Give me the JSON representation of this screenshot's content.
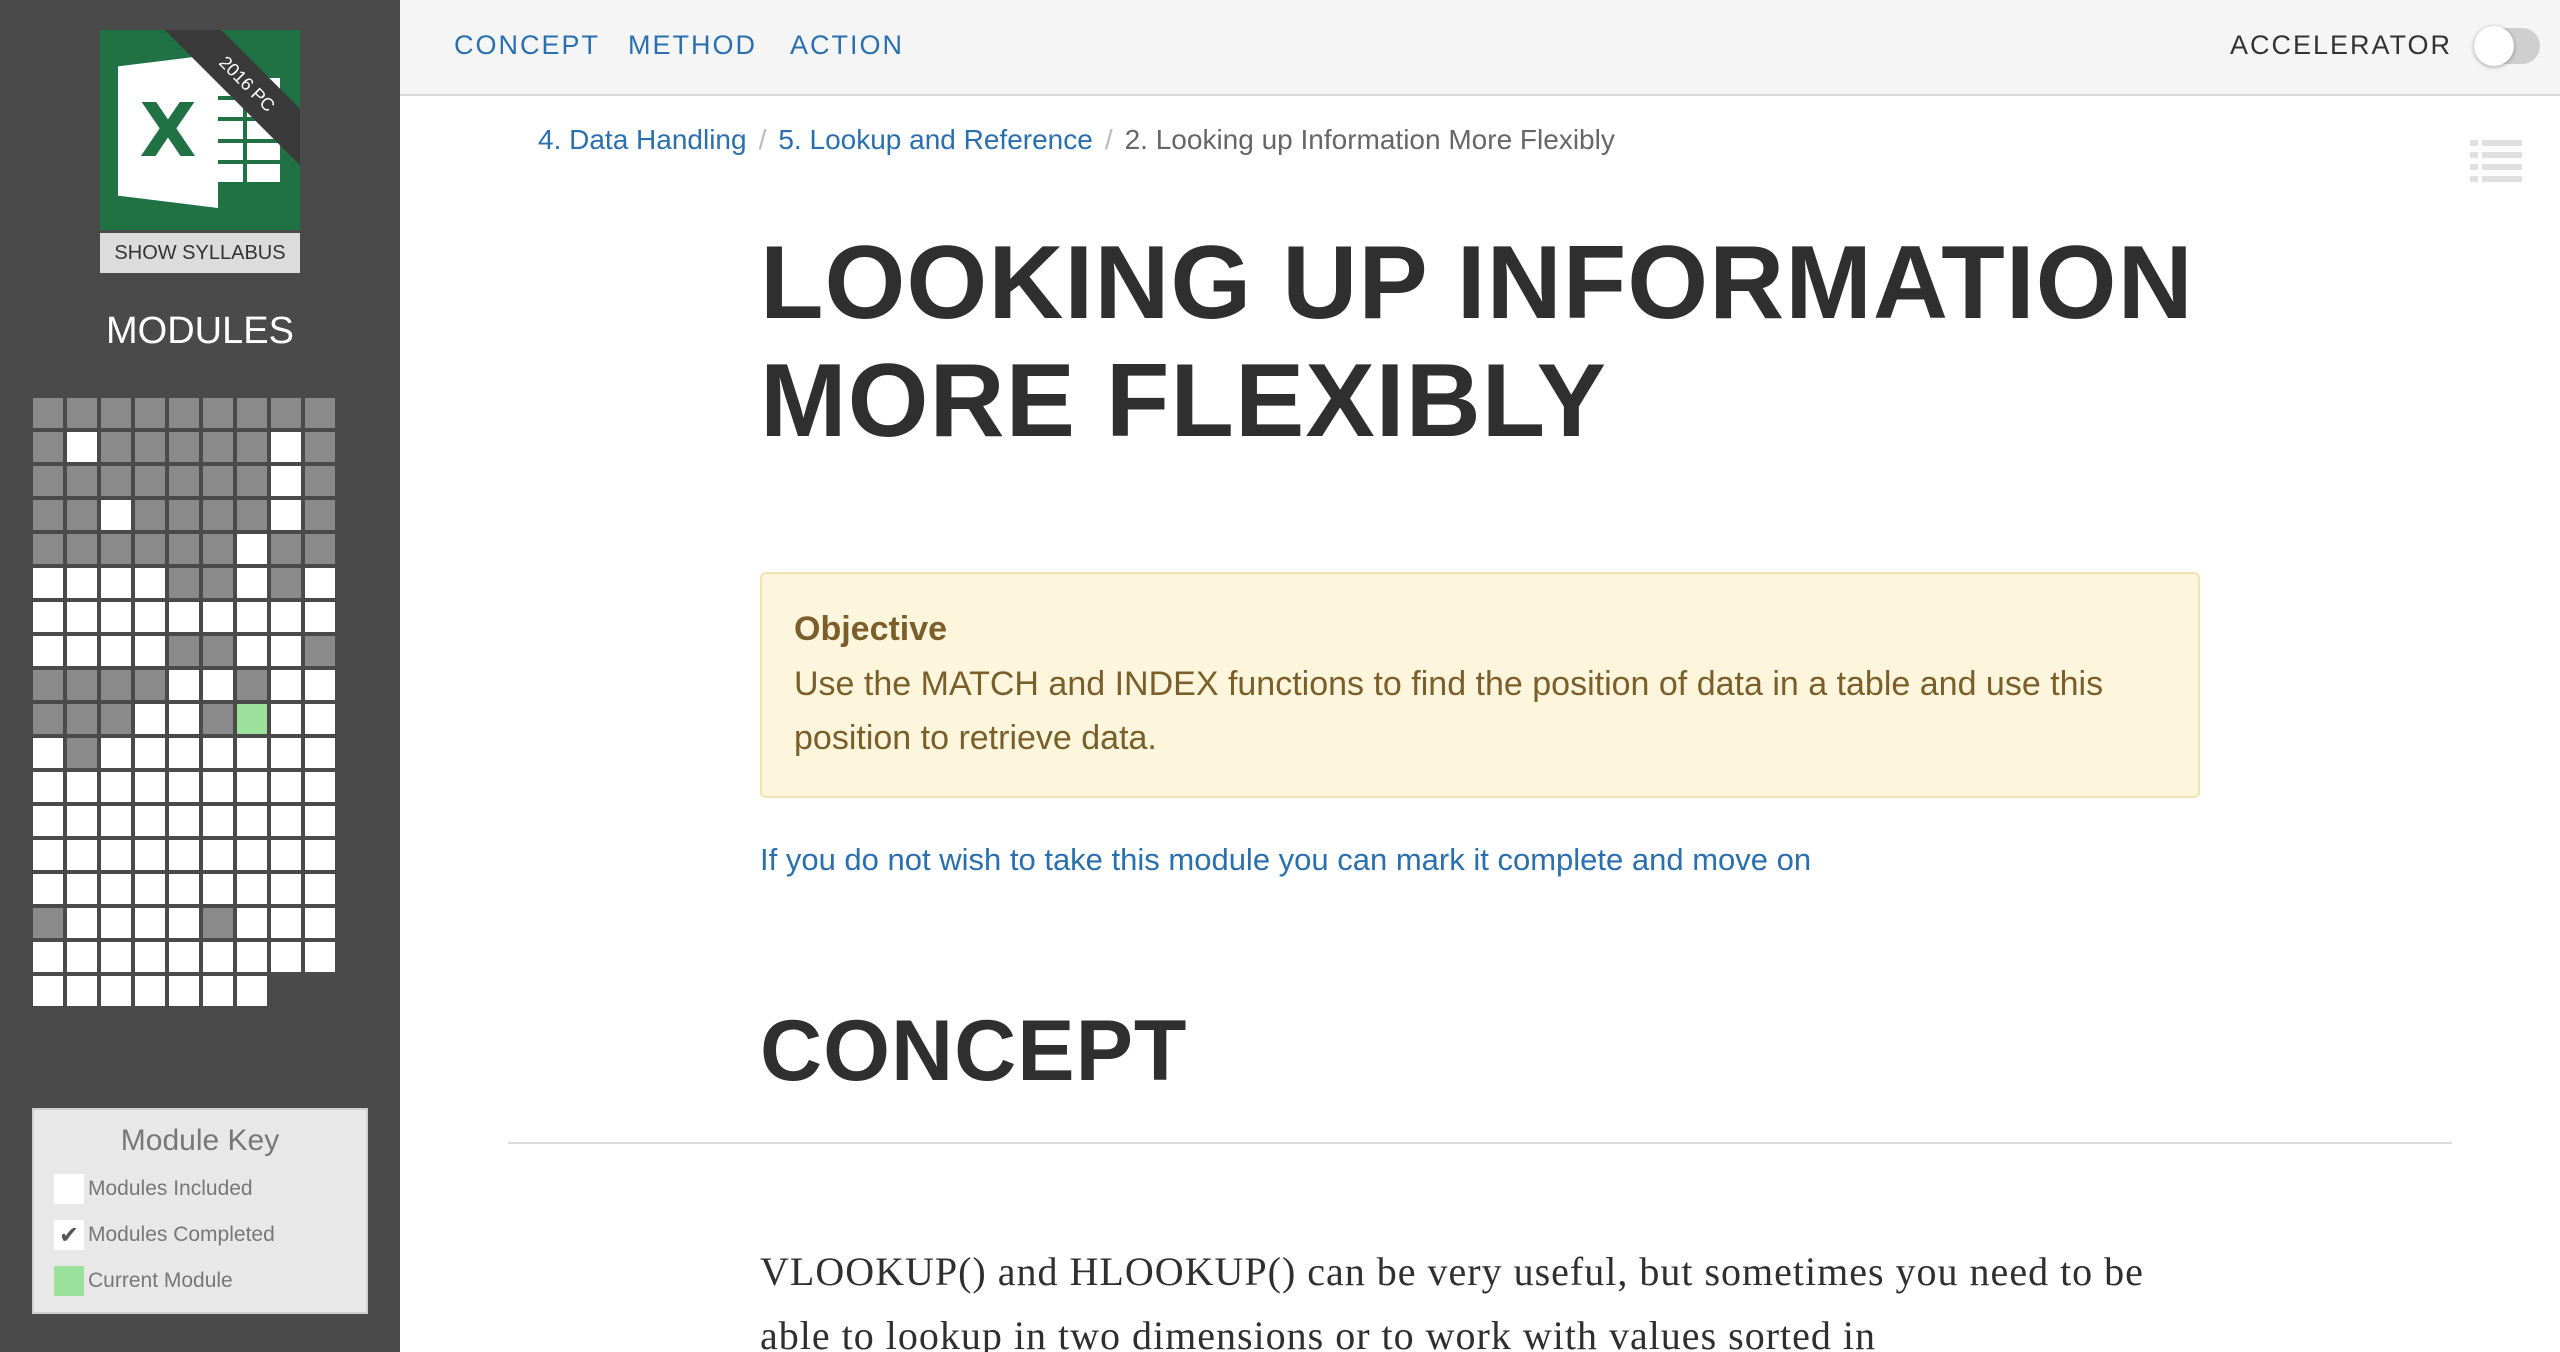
{
  "sidebar": {
    "logo_badge": "2016 PC",
    "logo_letter": "X",
    "syllabus_button": "SHOW SYLLABUS",
    "modules_title": "MODULES",
    "grid_rows": [
      "ggggggggg",
      "gwgggggwg",
      "gggggggwg",
      "ggwggggwg",
      "ggggggwgg",
      "wwwwggwgw",
      "wwwwwwwww",
      "wwwwggwwg",
      "ggggwwgww",
      "gggwwgcww",
      "wgwwwwwww",
      "wwwwwwwww",
      "wwwwwwwww",
      "wwwwwwwww",
      "wwwwwwwww",
      "gwwwwgwww",
      "wwwwwwwww",
      "wwwwwww"
    ],
    "key": {
      "title": "Module Key",
      "items": [
        {
          "label": "Modules Included",
          "swatch": "#ffffff",
          "mark": ""
        },
        {
          "label": "Modules Completed",
          "swatch": "#ffffff",
          "mark": "✔"
        },
        {
          "label": "Current Module",
          "swatch": "#9be19b",
          "mark": ""
        }
      ]
    }
  },
  "nav": {
    "concept": "CONCEPT",
    "method": "METHOD",
    "action": "ACTION",
    "accelerator": "ACCELERATOR",
    "accelerator_on": false
  },
  "breadcrumb": {
    "item1": "4. Data Handling",
    "sep": "/",
    "item2": "5. Lookup and Reference",
    "current": "2. Looking up Information More Flexibly"
  },
  "content": {
    "title_line1": "LOOKING UP INFORMATION",
    "title_line2": "MORE FLEXIBLY",
    "objective_title": "Objective",
    "objective_text": "Use the MATCH and INDEX functions to find the position of data in a table and use this position to retrieve data.",
    "skip_link": "If you do not wish to take this module you can mark it complete and move on",
    "section_title": "CONCEPT",
    "paragraph": "VLOOKUP() and HLOOKUP() can be very useful, but sometimes you need to be able to lookup in two dimensions or to work with values sorted in"
  },
  "colors": {
    "sidebar_bg": "#4a4a4a",
    "excel_green": "#207245",
    "link_blue": "#2a6fae",
    "objective_bg": "#fdf6dd",
    "objective_text": "#7a5f2b",
    "current_module": "#9be19b"
  }
}
